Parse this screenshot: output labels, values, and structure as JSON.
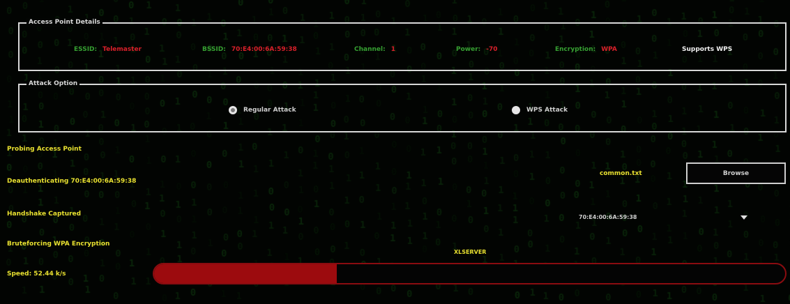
{
  "access_point": {
    "group_title": "Access Point Details",
    "essid_label": "ESSID:",
    "essid_value": "Telemaster",
    "bssid_label": "BSSID:",
    "bssid_value": "70:E4:00:6A:59:38",
    "channel_label": "Channel:",
    "channel_value": "1",
    "power_label": "Power:",
    "power_value": "-70",
    "encryption_label": "Encryption:",
    "encryption_value": "WPA",
    "wps_support": "Supports WPS"
  },
  "attack_options": {
    "group_title": "Attack Option",
    "regular_label": "Regular Attack",
    "wps_label": "WPS Attack",
    "selected": "regular"
  },
  "status": {
    "probing": "Probing Access Point",
    "deauth": "Deauthenticating 70:E4:00:6A:59:38",
    "handshake": "Handshake Captured",
    "bruteforce": "Bruteforcing WPA Encryption",
    "speed": "Speed: 52.44 k/s"
  },
  "wordlist": {
    "filename": "common.txt",
    "browse_label": "Browse"
  },
  "target_select": {
    "value": "70:E4:00:6A:59:38"
  },
  "server_name": "XLSERVER",
  "progress": {
    "fraction": 0.29
  },
  "colors": {
    "label_green": "#36a032",
    "value_red": "#d8202a",
    "status_yellow": "#e8e030",
    "progress_fill": "#9c0b0e",
    "progress_border": "#8a0c10"
  }
}
